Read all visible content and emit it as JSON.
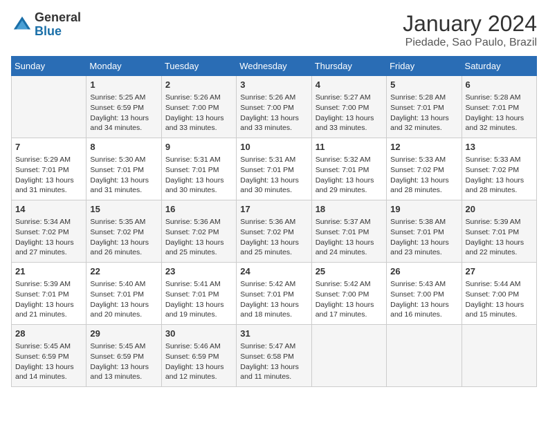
{
  "logo": {
    "general": "General",
    "blue": "Blue"
  },
  "title": "January 2024",
  "location": "Piedade, Sao Paulo, Brazil",
  "days_of_week": [
    "Sunday",
    "Monday",
    "Tuesday",
    "Wednesday",
    "Thursday",
    "Friday",
    "Saturday"
  ],
  "weeks": [
    [
      {
        "num": "",
        "info": ""
      },
      {
        "num": "1",
        "info": "Sunrise: 5:25 AM\nSunset: 6:59 PM\nDaylight: 13 hours\nand 34 minutes."
      },
      {
        "num": "2",
        "info": "Sunrise: 5:26 AM\nSunset: 7:00 PM\nDaylight: 13 hours\nand 33 minutes."
      },
      {
        "num": "3",
        "info": "Sunrise: 5:26 AM\nSunset: 7:00 PM\nDaylight: 13 hours\nand 33 minutes."
      },
      {
        "num": "4",
        "info": "Sunrise: 5:27 AM\nSunset: 7:00 PM\nDaylight: 13 hours\nand 33 minutes."
      },
      {
        "num": "5",
        "info": "Sunrise: 5:28 AM\nSunset: 7:01 PM\nDaylight: 13 hours\nand 32 minutes."
      },
      {
        "num": "6",
        "info": "Sunrise: 5:28 AM\nSunset: 7:01 PM\nDaylight: 13 hours\nand 32 minutes."
      }
    ],
    [
      {
        "num": "7",
        "info": "Sunrise: 5:29 AM\nSunset: 7:01 PM\nDaylight: 13 hours\nand 31 minutes."
      },
      {
        "num": "8",
        "info": "Sunrise: 5:30 AM\nSunset: 7:01 PM\nDaylight: 13 hours\nand 31 minutes."
      },
      {
        "num": "9",
        "info": "Sunrise: 5:31 AM\nSunset: 7:01 PM\nDaylight: 13 hours\nand 30 minutes."
      },
      {
        "num": "10",
        "info": "Sunrise: 5:31 AM\nSunset: 7:01 PM\nDaylight: 13 hours\nand 30 minutes."
      },
      {
        "num": "11",
        "info": "Sunrise: 5:32 AM\nSunset: 7:01 PM\nDaylight: 13 hours\nand 29 minutes."
      },
      {
        "num": "12",
        "info": "Sunrise: 5:33 AM\nSunset: 7:02 PM\nDaylight: 13 hours\nand 28 minutes."
      },
      {
        "num": "13",
        "info": "Sunrise: 5:33 AM\nSunset: 7:02 PM\nDaylight: 13 hours\nand 28 minutes."
      }
    ],
    [
      {
        "num": "14",
        "info": "Sunrise: 5:34 AM\nSunset: 7:02 PM\nDaylight: 13 hours\nand 27 minutes."
      },
      {
        "num": "15",
        "info": "Sunrise: 5:35 AM\nSunset: 7:02 PM\nDaylight: 13 hours\nand 26 minutes."
      },
      {
        "num": "16",
        "info": "Sunrise: 5:36 AM\nSunset: 7:02 PM\nDaylight: 13 hours\nand 25 minutes."
      },
      {
        "num": "17",
        "info": "Sunrise: 5:36 AM\nSunset: 7:02 PM\nDaylight: 13 hours\nand 25 minutes."
      },
      {
        "num": "18",
        "info": "Sunrise: 5:37 AM\nSunset: 7:01 PM\nDaylight: 13 hours\nand 24 minutes."
      },
      {
        "num": "19",
        "info": "Sunrise: 5:38 AM\nSunset: 7:01 PM\nDaylight: 13 hours\nand 23 minutes."
      },
      {
        "num": "20",
        "info": "Sunrise: 5:39 AM\nSunset: 7:01 PM\nDaylight: 13 hours\nand 22 minutes."
      }
    ],
    [
      {
        "num": "21",
        "info": "Sunrise: 5:39 AM\nSunset: 7:01 PM\nDaylight: 13 hours\nand 21 minutes."
      },
      {
        "num": "22",
        "info": "Sunrise: 5:40 AM\nSunset: 7:01 PM\nDaylight: 13 hours\nand 20 minutes."
      },
      {
        "num": "23",
        "info": "Sunrise: 5:41 AM\nSunset: 7:01 PM\nDaylight: 13 hours\nand 19 minutes."
      },
      {
        "num": "24",
        "info": "Sunrise: 5:42 AM\nSunset: 7:01 PM\nDaylight: 13 hours\nand 18 minutes."
      },
      {
        "num": "25",
        "info": "Sunrise: 5:42 AM\nSunset: 7:00 PM\nDaylight: 13 hours\nand 17 minutes."
      },
      {
        "num": "26",
        "info": "Sunrise: 5:43 AM\nSunset: 7:00 PM\nDaylight: 13 hours\nand 16 minutes."
      },
      {
        "num": "27",
        "info": "Sunrise: 5:44 AM\nSunset: 7:00 PM\nDaylight: 13 hours\nand 15 minutes."
      }
    ],
    [
      {
        "num": "28",
        "info": "Sunrise: 5:45 AM\nSunset: 6:59 PM\nDaylight: 13 hours\nand 14 minutes."
      },
      {
        "num": "29",
        "info": "Sunrise: 5:45 AM\nSunset: 6:59 PM\nDaylight: 13 hours\nand 13 minutes."
      },
      {
        "num": "30",
        "info": "Sunrise: 5:46 AM\nSunset: 6:59 PM\nDaylight: 13 hours\nand 12 minutes."
      },
      {
        "num": "31",
        "info": "Sunrise: 5:47 AM\nSunset: 6:58 PM\nDaylight: 13 hours\nand 11 minutes."
      },
      {
        "num": "",
        "info": ""
      },
      {
        "num": "",
        "info": ""
      },
      {
        "num": "",
        "info": ""
      }
    ]
  ]
}
